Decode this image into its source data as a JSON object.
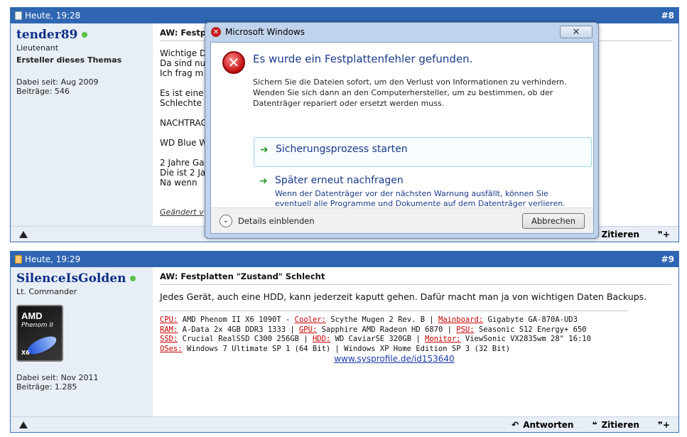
{
  "post8": {
    "date": "Heute, 19:28",
    "number": "#8",
    "username": "tender89",
    "rank": "Lieutenant",
    "starter": "Ersteller dieses Themas",
    "since": "Dabei seit: Aug 2009",
    "posts": "Beiträge: 546",
    "title": "AW: Festp",
    "lines": [
      "Wichtige D",
      "Da sind nu",
      "Ich frag m",
      "",
      "Es ist eine",
      "Schlechte",
      "",
      "NACHTRAG",
      "",
      "WD Blue W",
      "",
      "2 Jahre Ga",
      "Die ist 2 Ja",
      "Na wenn"
    ],
    "edited": "Geändert v",
    "quote_label": "Zitieren"
  },
  "post9": {
    "date": "Heute, 19:29",
    "number": "#9",
    "username": "SilenceIsGolden",
    "rank": "Lt. Commander",
    "since": "Dabei seit: Nov 2011",
    "posts": "Beiträge: 1.285",
    "logo": {
      "brand": "AMD",
      "model": "Phenom II",
      "tag": "X6"
    },
    "title": "AW: Festplatten \"Zustand\" Schlecht",
    "body": "Jedes Gerät, auch eine HDD, kann jederzeit kaputt gehen. Dafür macht man ja von wichtigen Daten Backups.",
    "sig": {
      "cpu_k": "CPU:",
      "cpu_v": " AMD Phenom II X6 1090T - ",
      "cooler_k": "Cooler:",
      "cooler_v": " Scythe Mugen 2 Rev. B | ",
      "mb_k": "Mainboard:",
      "mb_v": " Gigabyte GA-870A-UD3",
      "ram_k": "RAM:",
      "ram_v": " A-Data 2x 4GB DDR3 1333 | ",
      "gpu_k": "GPU:",
      "gpu_v": " Sapphire AMD Radeon HD 6870 | ",
      "psu_k": "PSU:",
      "psu_v": " Seasonic S12 Energy+ 650",
      "ssd_k": "SSD:",
      "ssd_v": " Crucial RealSSD C300 256GB | ",
      "hdd_k": "HDD:",
      "hdd_v": " WD CaviarSE 320GB | ",
      "mon_k": "Monitor:",
      "mon_v": " ViewSonic VX2835wm 28\" 16:10",
      "os_k": "OSes:",
      "os_v": " Windows 7 Ultimate SP 1 (64 Bit) | Windows XP Home Edition SP 3 (32 Bit)",
      "link": "www.sysprofile.de/id153640"
    },
    "reply_label": "Antworten",
    "quote_label": "Zitieren"
  },
  "dialog": {
    "title": "Microsoft Windows",
    "close": "✕",
    "main": "Es wurde ein Festplattenfehler gefunden.",
    "desc": "Sichern Sie die Dateien sofort, um den Verlust von Informationen zu verhindern. Wenden Sie sich dann an den Computerhersteller, um zu bestimmen, ob der Datenträger repariert oder ersetzt werden muss.",
    "cmd1": "Sicherungsprozess starten",
    "cmd2": "Später erneut nachfragen",
    "cmd2_sub": "Wenn der Datenträger vor der nächsten Warnung ausfällt, können Sie eventuell alle Programme und Dokumente auf dem Datenträger verlieren.",
    "details": "Details einblenden",
    "cancel": "Abbrechen"
  }
}
